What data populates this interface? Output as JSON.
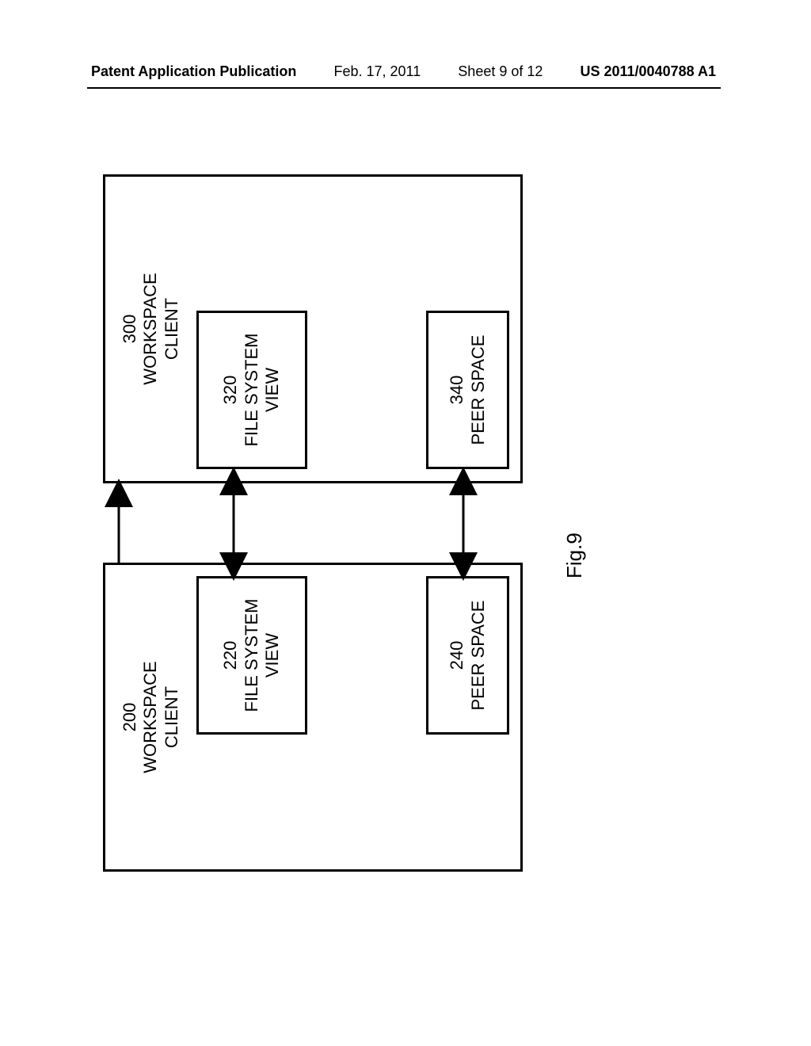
{
  "header": {
    "pub_label": "Patent Application Publication",
    "date": "Feb. 17, 2011",
    "sheet": "Sheet 9 of 12",
    "pub_no": "US 2011/0040788 A1"
  },
  "figure_label": "Fig.9",
  "left_client": {
    "id": "200",
    "title": "WORKSPACE\nCLIENT",
    "fsv_id": "220",
    "fsv_label": "FILE SYSTEM\nVIEW",
    "peer_id": "240",
    "peer_label": "PEER SPACE"
  },
  "right_client": {
    "id": "300",
    "title": "WORKSPACE\nCLIENT",
    "fsv_id": "320",
    "fsv_label": "FILE SYSTEM\nVIEW",
    "peer_id": "340",
    "peer_label": "PEER SPACE"
  }
}
